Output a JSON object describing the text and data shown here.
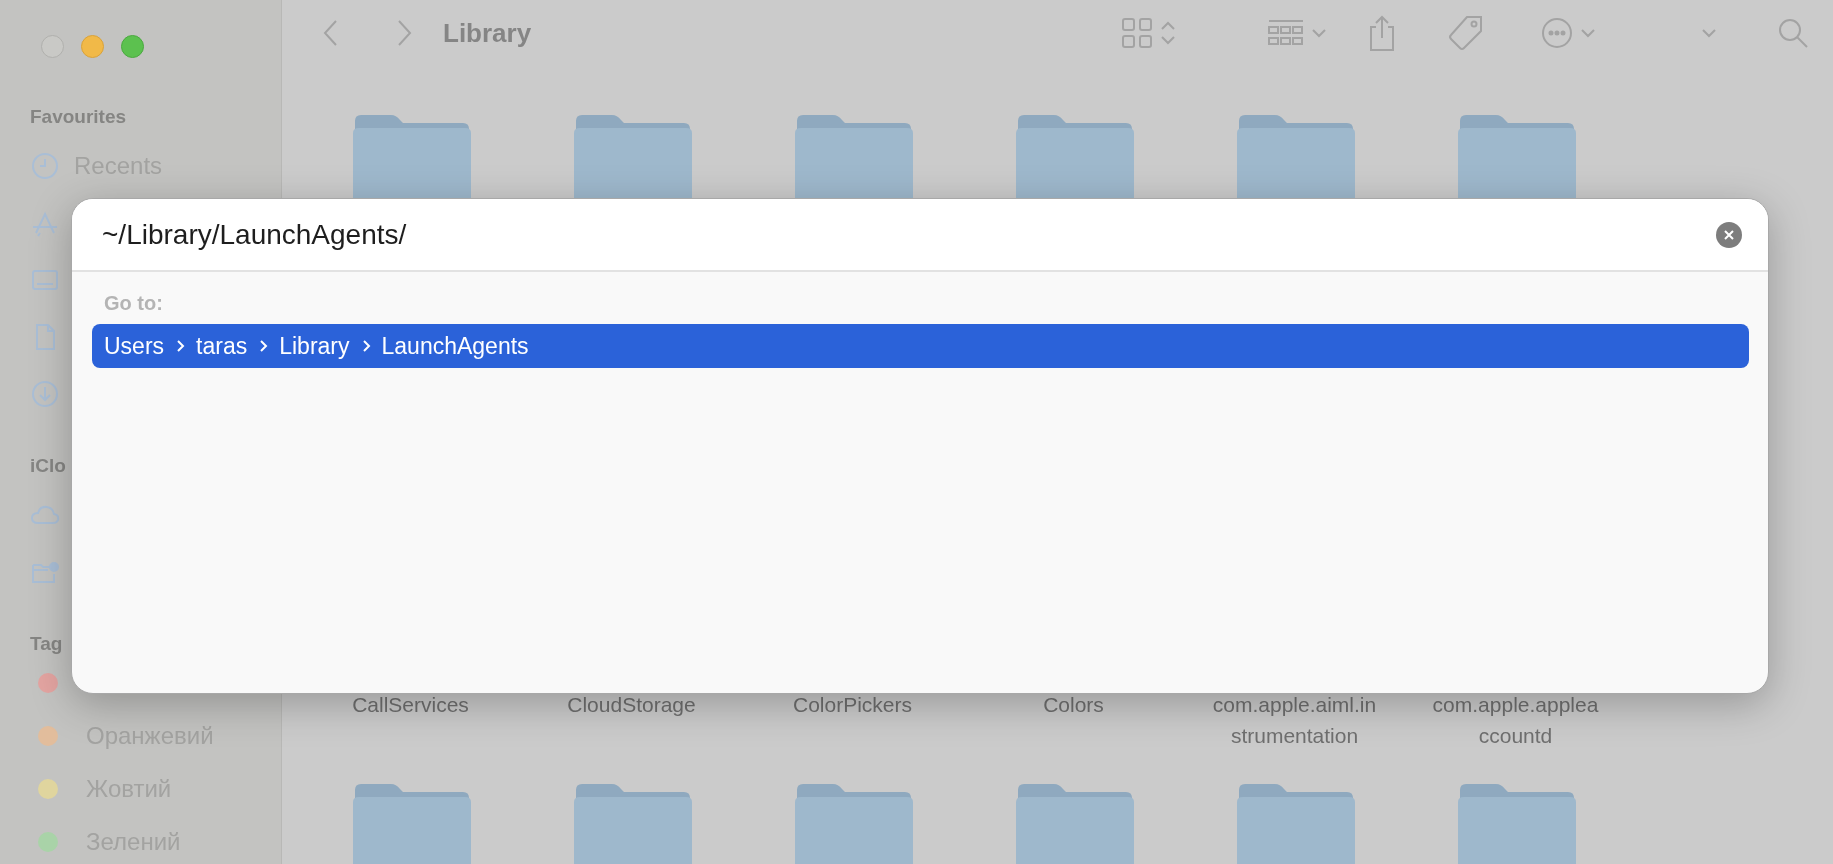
{
  "sidebar": {
    "sections": [
      {
        "title": "Favourites",
        "items": [
          {
            "kind": "labelled",
            "label": "Recents"
          },
          {
            "kind": "icon-only"
          },
          {
            "kind": "icon-only"
          },
          {
            "kind": "icon-only"
          },
          {
            "kind": "icon-only"
          }
        ]
      },
      {
        "title": "iClo",
        "items": [
          {
            "kind": "icon-only"
          },
          {
            "kind": "icon-only"
          }
        ]
      }
    ],
    "tags": {
      "title": "Tag",
      "items": [
        {
          "color": "#e3a4a1"
        },
        {
          "label": "Оранжевий",
          "color": "#e2bd9c"
        },
        {
          "label": "Жовтий",
          "color": "#e0d59e"
        },
        {
          "label": "Зелений",
          "color": "#a9d3a8"
        }
      ]
    }
  },
  "toolbar": {
    "title": "Library"
  },
  "folders": {
    "labels": [
      "CallServices",
      "CloudStorage",
      "ColorPickers",
      "Colors",
      "com.apple.aiml.in\nstrumentation",
      "com.apple.applea\nccountd"
    ]
  },
  "go_to_dialog": {
    "path": "~/Library/LaunchAgents/",
    "heading": "Go to:",
    "results": [
      {
        "segments": [
          "Users",
          "taras",
          "Library",
          "LaunchAgents"
        ],
        "selected": true
      }
    ]
  }
}
